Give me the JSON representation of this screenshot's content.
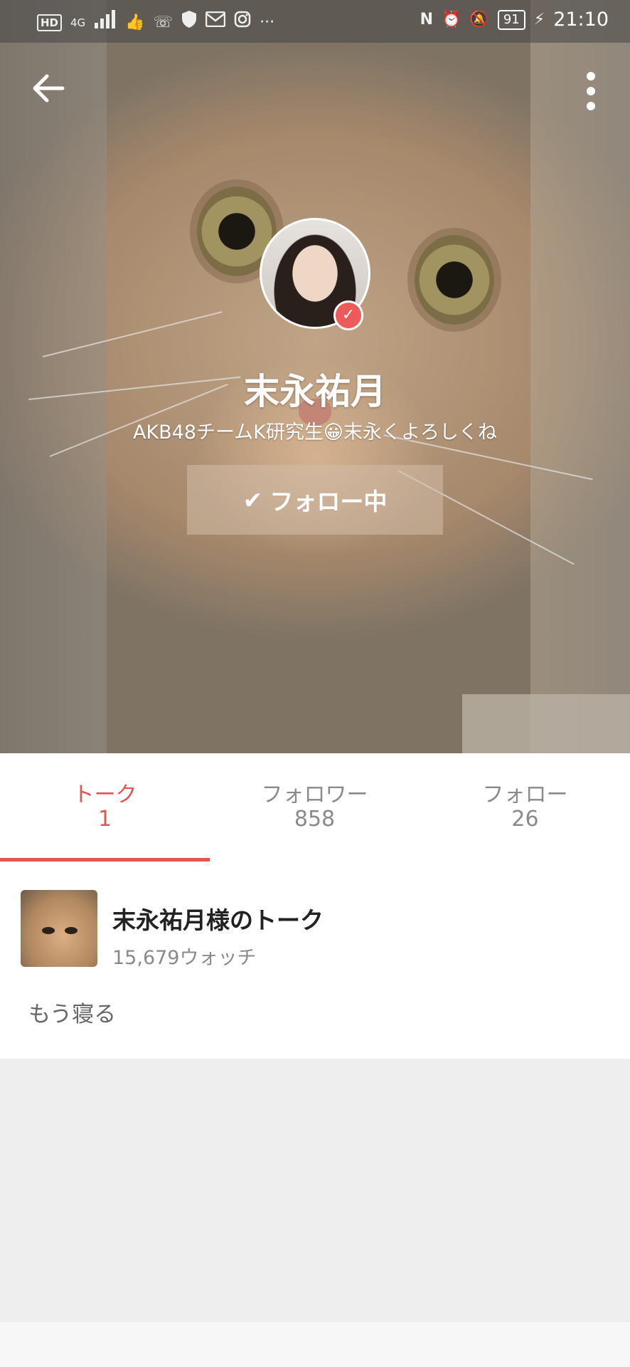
{
  "status_bar": {
    "left_icons": [
      "HD",
      "4G",
      "signal",
      "notification",
      "vpn",
      "shield",
      "mail",
      "instagram",
      "more"
    ],
    "battery": "91",
    "time": "21:10"
  },
  "profile": {
    "name": "末永祐月",
    "bio": "AKB48チームK研究生😀末永くよろしくね",
    "follow_button": "フォロー中",
    "follow_check": "✔"
  },
  "tabs": [
    {
      "label": "トーク",
      "count": "1"
    },
    {
      "label": "フォロワー",
      "count": "858"
    },
    {
      "label": "フォロー",
      "count": "26"
    }
  ],
  "talk": {
    "title": "末永祐月様のトーク",
    "watch_count": "15,679ウォッチ",
    "latest_message": "もう寝る"
  },
  "colors": {
    "accent": "#e3554d",
    "verified": "#ee5a5a"
  }
}
